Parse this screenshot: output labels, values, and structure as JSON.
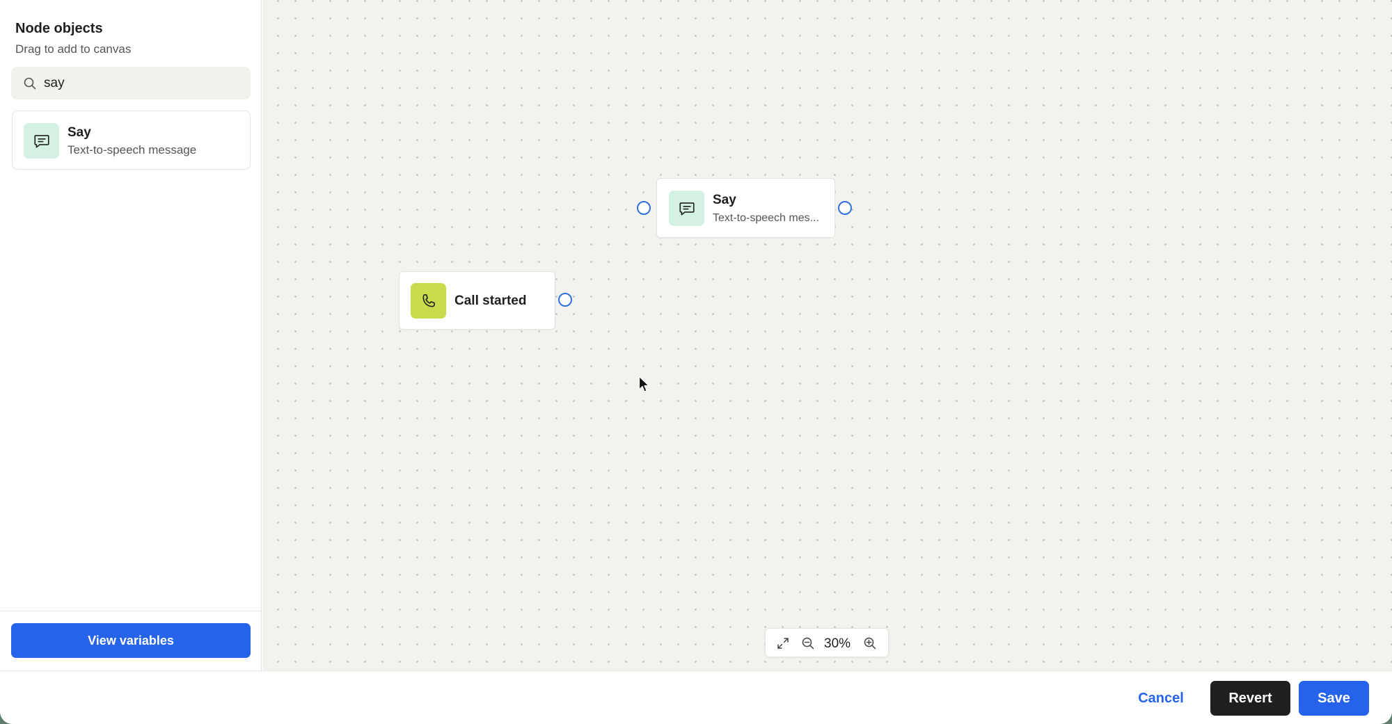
{
  "sidebar": {
    "title": "Node objects",
    "subtitle": "Drag to add to canvas",
    "search": {
      "value": "say",
      "placeholder": "Search",
      "icon": "search-icon"
    },
    "results": [
      {
        "name": "Say",
        "description": "Text-to-speech message",
        "icon": "chat-bubble-icon",
        "icon_bg": "#d4f1e4"
      }
    ],
    "view_variables_label": "View variables"
  },
  "canvas": {
    "nodes": [
      {
        "name": "Say",
        "description": "Text-to-speech mes...",
        "icon": "chat-bubble-icon",
        "icon_bg": "#d4f1e4"
      },
      {
        "name": "Call started",
        "icon": "phone-icon",
        "icon_bg": "#c8dc4e"
      }
    ],
    "zoom": {
      "level": "30%"
    }
  },
  "footer": {
    "cancel_label": "Cancel",
    "revert_label": "Revert",
    "save_label": "Save"
  },
  "colors": {
    "accent": "#2563eb",
    "dark_button": "#1f1f1f",
    "port": "#2f6fe0"
  }
}
